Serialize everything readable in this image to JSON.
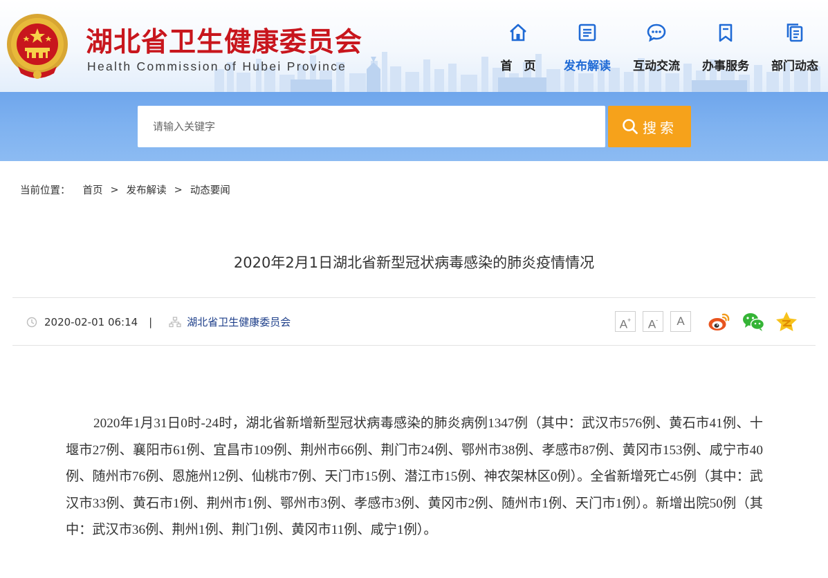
{
  "header": {
    "title": "湖北省卫生健康委员会",
    "subtitle": "Health Commission of Hubei Province",
    "nav": [
      {
        "label": "首　页",
        "icon": "home-icon",
        "active": false
      },
      {
        "label": "发布解读",
        "icon": "document-icon",
        "active": true
      },
      {
        "label": "互动交流",
        "icon": "chat-icon",
        "active": false
      },
      {
        "label": "办事服务",
        "icon": "bookmark-icon",
        "active": false
      },
      {
        "label": "部门动态",
        "icon": "copy-icon",
        "active": false
      }
    ]
  },
  "search": {
    "placeholder": "请输入关键字",
    "button_label": "搜索"
  },
  "breadcrumb": {
    "prefix": "当前位置：",
    "items": [
      "首页",
      "发布解读",
      "动态要闻"
    ],
    "separator": ">"
  },
  "article": {
    "title": "2020年2月1日湖北省新型冠状病毒感染的肺炎疫情情况",
    "date": "2020-02-01 06:14",
    "meta_divider": "|",
    "source": "湖北省卫生健康委员会",
    "font_controls": [
      "A+",
      "A-",
      "A"
    ],
    "share": [
      "weibo-icon",
      "wechat-icon",
      "qzone-icon"
    ],
    "body": "2020年1月31日0时-24时，湖北省新增新型冠状病毒感染的肺炎病例1347例（其中：武汉市576例、黄石市41例、十堰市27例、襄阳市61例、宜昌市109例、荆州市66例、荆门市24例、鄂州市38例、孝感市87例、黄冈市153例、咸宁市40例、随州市76例、恩施州12例、仙桃市7例、天门市15例、潜江市15例、神农架林区0例）。全省新增死亡45例（其中：武汉市33例、黄石市1例、荆州市1例、鄂州市3例、孝感市3例、黄冈市2例、随州市1例、天门市1例）。新增出院50例（其中：武汉市36例、荆州1例、荆门1例、黄冈市11例、咸宁1例）。"
  },
  "colors": {
    "brand_red": "#c8161d",
    "nav_active": "#1f6ad5",
    "search_band": "#7fb2f0",
    "search_button": "#f6a21b",
    "source_link": "#1e3f8a"
  }
}
